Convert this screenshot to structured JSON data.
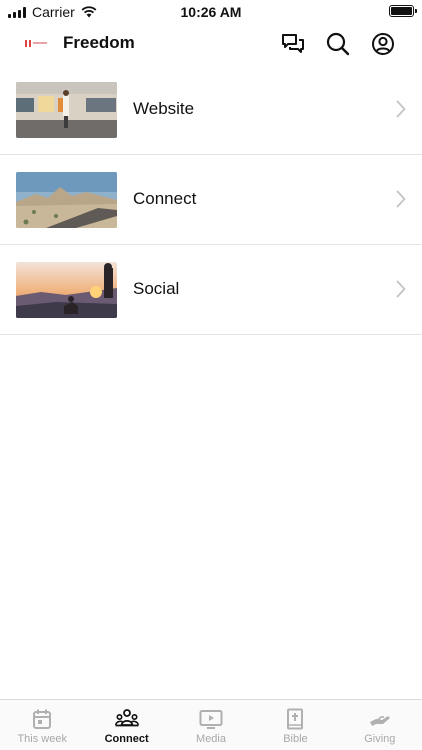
{
  "status_bar": {
    "carrier": "Carrier",
    "time": "10:26 AM"
  },
  "header": {
    "title": "Freedom",
    "icons": [
      "chat-icon",
      "search-icon",
      "account-icon"
    ]
  },
  "items": [
    {
      "label": "Website",
      "image": "train-station-photo"
    },
    {
      "label": "Connect",
      "image": "desert-road-photo"
    },
    {
      "label": "Social",
      "image": "sunset-hikers-photo"
    }
  ],
  "tabs": [
    {
      "label": "This week",
      "icon": "calendar-icon",
      "active": false
    },
    {
      "label": "Connect",
      "icon": "people-icon",
      "active": true
    },
    {
      "label": "Media",
      "icon": "video-icon",
      "active": false
    },
    {
      "label": "Bible",
      "icon": "bible-icon",
      "active": false
    },
    {
      "label": "Giving",
      "icon": "giving-hand-icon",
      "active": false
    }
  ]
}
